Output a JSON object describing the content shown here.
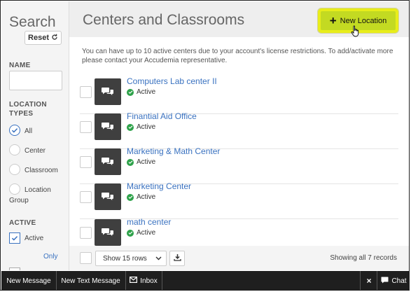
{
  "sidebar": {
    "title": "Search",
    "reset_label": "Reset",
    "name_label": "NAME",
    "location_types_label": "LOCATION TYPES",
    "location_types": [
      {
        "label": "All",
        "checked": true
      },
      {
        "label": "Center",
        "checked": false
      },
      {
        "label": "Classroom",
        "checked": false
      },
      {
        "label": "Location Group",
        "checked": false
      }
    ],
    "active_label": "ACTIVE",
    "active_option": "Active",
    "only_link": "Only"
  },
  "header": {
    "title": "Centers and Classrooms",
    "new_location_label": "New Location"
  },
  "info_text": "You can have up to 10 active centers due to your account's license restrictions. To add/activate more please contact your Accudemia representative.",
  "locations": [
    {
      "name": "Computers Lab center II",
      "status": "Active"
    },
    {
      "name": "Finantial Aid Office",
      "status": "Active"
    },
    {
      "name": "Marketing & Math Center",
      "status": "Active"
    },
    {
      "name": "Marketing Center",
      "status": "Active"
    },
    {
      "name": "math center",
      "status": "Active"
    }
  ],
  "list_footer": {
    "rows_select": "Show 15 rows",
    "showing": "Showing all 7 records"
  },
  "bottom_bar": {
    "new_message": "New Message",
    "new_text_message": "New Text Message",
    "inbox": "Inbox",
    "close": "×",
    "chat": "Chat"
  },
  "colors": {
    "accent": "#3a72c0",
    "new_button": "#c3da22",
    "status_ok": "#2ea24a",
    "bottom_bar": "#1f1f1f"
  }
}
